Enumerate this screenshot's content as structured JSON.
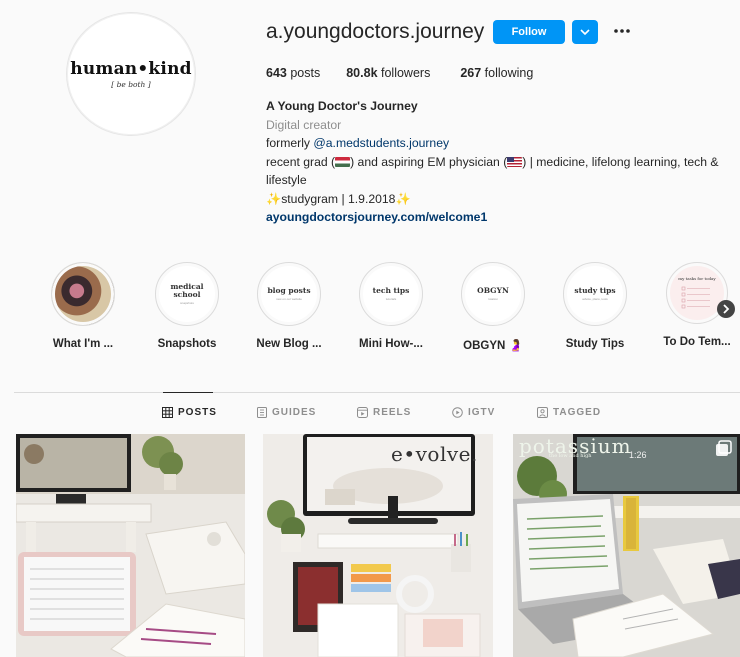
{
  "profile": {
    "avatar_title": "human•kind",
    "avatar_subtitle": "[ be both ]",
    "username": "a.youngdoctors.journey",
    "follow_label": "Follow",
    "stats": {
      "posts_count": "643",
      "posts_label": "posts",
      "followers_count": "80.8k",
      "followers_label": "followers",
      "following_count": "267",
      "following_label": "following"
    },
    "bio": {
      "name": "A Young Doctor's Journey",
      "category": "Digital creator",
      "formerly_prefix": "formerly ",
      "formerly_handle": "@a.medstudents.journey",
      "line_part1": "recent grad (",
      "line_part2": ") and aspiring EM physician (",
      "line_part3": ") | medicine, lifelong learning, tech &",
      "line_wrap": "lifestyle",
      "studygram": "studygram | 1.9.2018",
      "website": "ayoungdoctorsjourney.com/welcome1"
    }
  },
  "highlights": [
    {
      "label": "What I'm ...",
      "cover_title": "",
      "cover_sub": "",
      "icon": "photo-cover"
    },
    {
      "label": "Snapshots",
      "cover_title": "medical school",
      "cover_sub": "snapshots"
    },
    {
      "label": "New Blog ...",
      "cover_title": "blog posts",
      "cover_sub": "new on our website"
    },
    {
      "label": "Mini How-...",
      "cover_title": "tech tips",
      "cover_sub": "tutorials"
    },
    {
      "label": "OBGYN 🤰",
      "cover_title": "OBGYN",
      "cover_sub": "rotation"
    },
    {
      "label": "Study Tips",
      "cover_title": "study tips",
      "cover_sub": "advice, plans, tools"
    },
    {
      "label": "To Do Tem...",
      "cover_title": "my tasks for today",
      "cover_sub": ""
    }
  ],
  "tabs": [
    {
      "label": "POSTS",
      "icon": "grid-icon",
      "active": true
    },
    {
      "label": "GUIDES",
      "icon": "guides-icon",
      "active": false
    },
    {
      "label": "REELS",
      "icon": "reels-icon",
      "active": false
    },
    {
      "label": "IGTV",
      "icon": "igtv-icon",
      "active": false
    },
    {
      "label": "TAGGED",
      "icon": "tagged-icon",
      "active": false
    }
  ],
  "posts": [
    {
      "overlay_text": ""
    },
    {
      "overlay_text": "e•volve."
    },
    {
      "overlay_text": "potassium",
      "overlay_sub": "the low and high",
      "time": "1:26"
    }
  ],
  "colors": {
    "accent": "#0095f6",
    "link": "#00376b",
    "muted": "#8e8e8e",
    "text": "#262626",
    "background": "#fafafa"
  }
}
